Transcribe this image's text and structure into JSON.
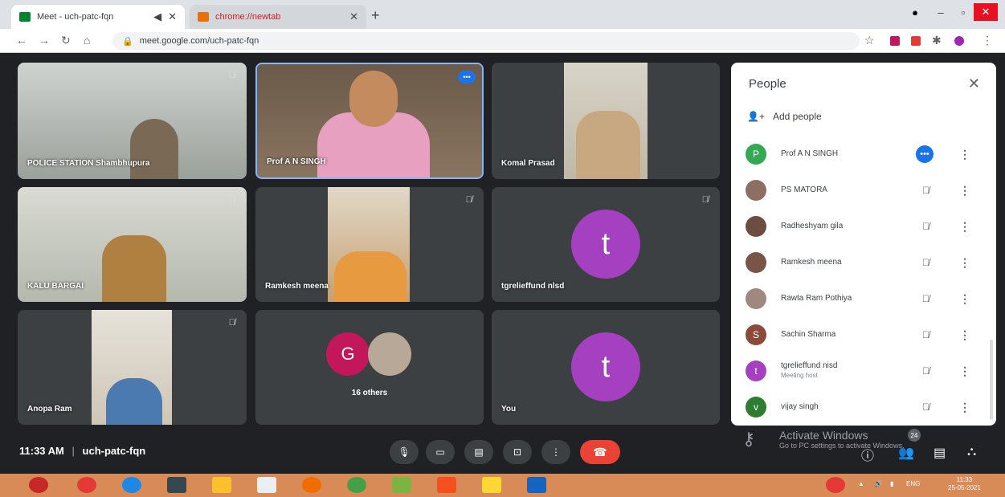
{
  "browser": {
    "tabs": [
      {
        "title": "Meet - uch-patc-fqn",
        "active": true
      },
      {
        "title": "chrome://newtab",
        "active": false
      }
    ],
    "new_tab": "+",
    "address": "meet.google.com/uch-patc-fqn",
    "window_controls": [
      "–",
      "▫",
      "✕"
    ]
  },
  "tiles": [
    {
      "name": "POLICE STATION Shambhupura",
      "muted": true
    },
    {
      "name": "Prof A N SINGH",
      "muted": false,
      "highlight": true
    },
    {
      "name": "Komal Prasad",
      "muted": false
    },
    {
      "name": "KALU BARGAI",
      "muted": true
    },
    {
      "name": "Ramkesh meena",
      "muted": true
    },
    {
      "name": "tgrelieffund nlsd",
      "muted": true,
      "avatar": "t"
    },
    {
      "name": "Anopa Ram",
      "muted": true
    },
    {
      "name": "16 others",
      "avatar_g": "G"
    },
    {
      "name": "You",
      "avatar": "t"
    }
  ],
  "people_panel": {
    "title": "People",
    "close": "✕",
    "add_people": "Add people",
    "participants": [
      {
        "name": "Prof A N SINGH",
        "initial": "P",
        "color": "#34a853",
        "host_menu": "•••"
      },
      {
        "name": "PS MATORA",
        "initial": "",
        "color": "#8d6e63"
      },
      {
        "name": "Radheshyam gila",
        "initial": "",
        "color": "#6d4c41"
      },
      {
        "name": "Ramkesh meena",
        "initial": "",
        "color": "#795548"
      },
      {
        "name": "Rawta Ram Pothiya",
        "initial": "",
        "color": "#a1887f"
      },
      {
        "name": "Sachin Sharma",
        "initial": "S",
        "color": "#8d4a3a"
      },
      {
        "name": "tgrelieffund nisd",
        "sub": "Meeting host",
        "initial": "t",
        "color": "#a541c0"
      },
      {
        "name": "vijay singh",
        "initial": "v",
        "color": "#2e7d32"
      }
    ]
  },
  "bottom_bar": {
    "time": "11:33 AM",
    "separator": "|",
    "meeting_code": "uch-patc-fqn",
    "participants_count": "24",
    "activate_title": "Activate Windows",
    "activate_sub": "Go to PC settings to activate Windows."
  },
  "taskbar": {
    "lang": "ENG",
    "time": "11:33",
    "date": "25-05-2021"
  }
}
